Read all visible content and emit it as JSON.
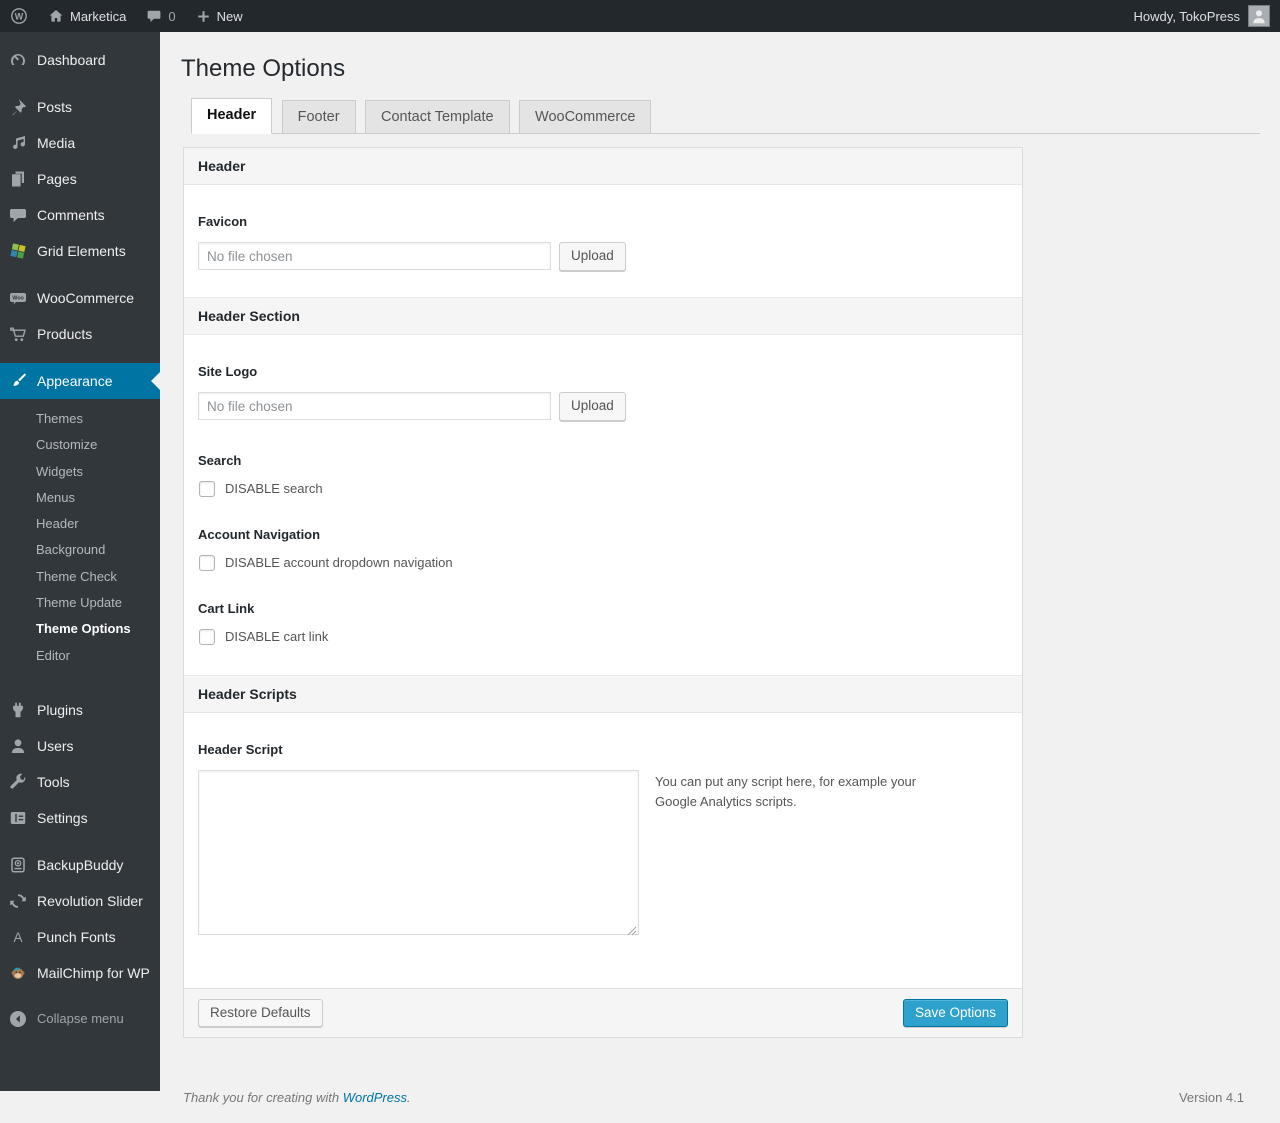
{
  "admin_bar": {
    "site_name": "Marketica",
    "comment_count": "0",
    "new_label": "New",
    "howdy": "Howdy, TokoPress"
  },
  "sidebar": {
    "items": [
      {
        "icon": "dashboard-icon",
        "label": "Dashboard"
      },
      {
        "icon": "pushpin-icon",
        "label": "Posts"
      },
      {
        "icon": "media-icon",
        "label": "Media"
      },
      {
        "icon": "pages-icon",
        "label": "Pages"
      },
      {
        "icon": "comments-icon",
        "label": "Comments"
      },
      {
        "icon": "grid-elements-icon",
        "label": "Grid Elements"
      },
      {
        "icon": "woocommerce-icon",
        "label": "WooCommerce"
      },
      {
        "icon": "cart-icon",
        "label": "Products"
      },
      {
        "icon": "brush-icon",
        "label": "Appearance"
      },
      {
        "icon": "plugin-icon",
        "label": "Plugins"
      },
      {
        "icon": "users-icon",
        "label": "Users"
      },
      {
        "icon": "tools-icon",
        "label": "Tools"
      },
      {
        "icon": "settings-icon",
        "label": "Settings"
      },
      {
        "icon": "backupbuddy-icon",
        "label": "BackupBuddy"
      },
      {
        "icon": "revolution-slider-icon",
        "label": "Revolution Slider"
      },
      {
        "icon": "punch-fonts-icon",
        "label": "Punch Fonts"
      },
      {
        "icon": "mailchimp-icon",
        "label": "MailChimp for WP"
      },
      {
        "icon": "collapse-icon",
        "label": "Collapse menu"
      }
    ],
    "submenu": {
      "parent": "Appearance",
      "current": "Theme Options",
      "items": [
        "Themes",
        "Customize",
        "Widgets",
        "Menus",
        "Header",
        "Background",
        "Theme Check",
        "Theme Update",
        "Theme Options",
        "Editor"
      ]
    }
  },
  "page": {
    "title": "Theme Options",
    "tabs": [
      {
        "label": "Header",
        "active": true
      },
      {
        "label": "Footer",
        "active": false
      },
      {
        "label": "Contact Template",
        "active": false
      },
      {
        "label": "WooCommerce",
        "active": false
      }
    ]
  },
  "panel": {
    "section_header_1": "Header",
    "favicon": {
      "label": "Favicon",
      "placeholder": "No file chosen",
      "button": "Upload"
    },
    "section_header_2": "Header Section",
    "site_logo": {
      "label": "Site Logo",
      "placeholder": "No file chosen",
      "button": "Upload"
    },
    "search": {
      "label": "Search",
      "checkbox": "DISABLE search",
      "checked": false
    },
    "account_nav": {
      "label": "Account Navigation",
      "checkbox": "DISABLE account dropdown navigation",
      "checked": false
    },
    "cart_link": {
      "label": "Cart Link",
      "checkbox": "DISABLE cart link",
      "checked": false
    },
    "section_header_3": "Header Scripts",
    "header_script": {
      "label": "Header Script",
      "value": "",
      "help": "You can put any script here, for example your Google Analytics scripts."
    },
    "restore_button": "Restore Defaults",
    "save_button": "Save Options"
  },
  "footer": {
    "thanks_prefix": "Thank you for creating with ",
    "wordpress_link": "WordPress",
    "thanks_suffix": ".",
    "version": "Version 4.1"
  },
  "colors": {
    "accent": "#0074a2",
    "primary_button": "#2ea2cc",
    "admin_bar_bg": "#23282d",
    "sidebar_bg": "#32373c",
    "page_bg": "#f1f1f1"
  }
}
